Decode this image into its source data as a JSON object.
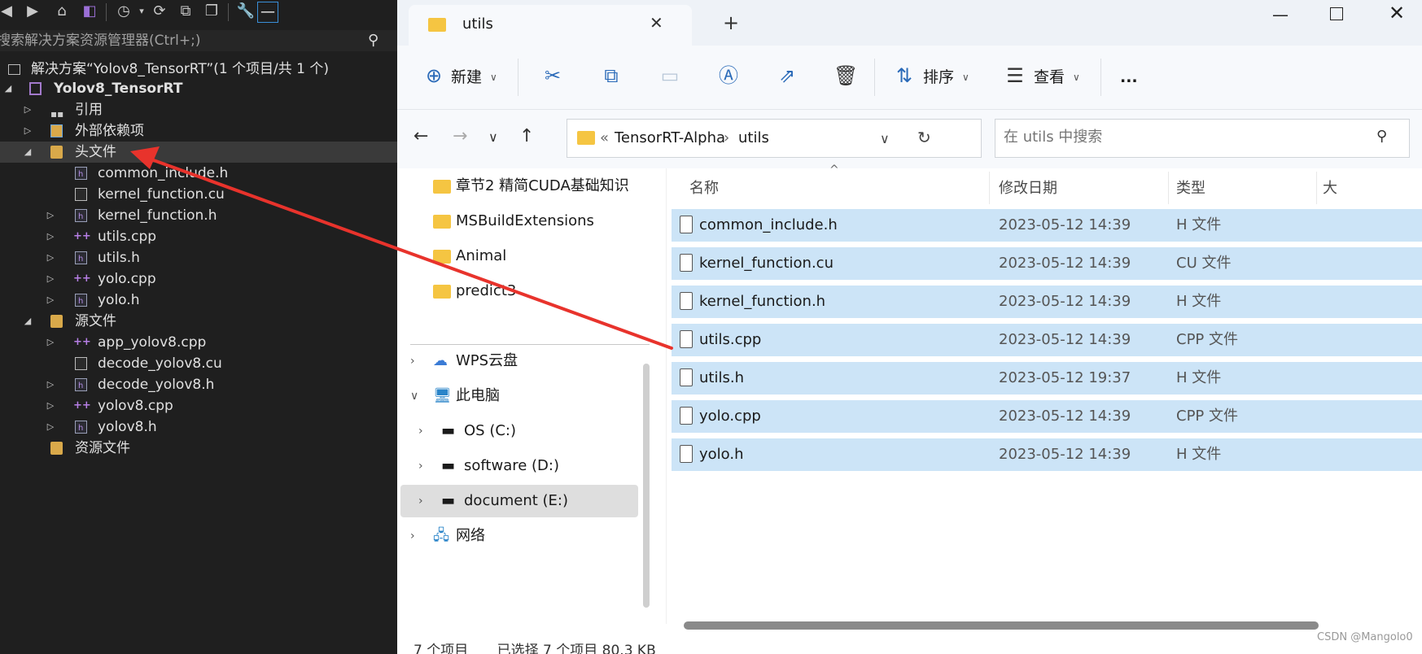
{
  "solution_explorer": {
    "search_placeholder": "搜索解决方案资源管理器(Ctrl+;)",
    "solution_label": "解决方案“Yolov8_TensorRT”(1 个项目/共 1 个)",
    "project_label": "Yolov8_TensorRT",
    "nodes": {
      "references": "引用",
      "external_deps": "外部依赖项",
      "header_files": "头文件",
      "h1": "common_include.h",
      "h2": "kernel_function.cu",
      "h3": "kernel_function.h",
      "h4": "utils.cpp",
      "h5": "utils.h",
      "h6": "yolo.cpp",
      "h7": "yolo.h",
      "source_files": "源文件",
      "s1": "app_yolov8.cpp",
      "s2": "decode_yolov8.cu",
      "s3": "decode_yolov8.h",
      "s4": "yolov8.cpp",
      "s5": "yolov8.h",
      "resource_files": "资源文件"
    }
  },
  "explorer": {
    "tab_title": "utils",
    "commands": {
      "new": "新建",
      "sort": "排序",
      "view": "查看",
      "more": "..."
    },
    "breadcrumb": {
      "prefix": "«",
      "parent": "TensorRT-Alpha",
      "current": "utils"
    },
    "search_placeholder": "在 utils 中搜索",
    "nav_items": {
      "n1": "章节2 精简CUDA基础知识",
      "n2": "MSBuildExtensions",
      "n3": "Animal",
      "n4": "predict3",
      "n5": "WPS云盘",
      "n6": "此电脑",
      "n7": "OS (C:)",
      "n8": "software (D:)",
      "n9": "document (E:)",
      "n10": "网络"
    },
    "columns": {
      "name": "名称",
      "date": "修改日期",
      "type": "类型",
      "size": "大"
    },
    "files": [
      {
        "name": "common_include.h",
        "date": "2023-05-12 14:39",
        "type": "H 文件"
      },
      {
        "name": "kernel_function.cu",
        "date": "2023-05-12 14:39",
        "type": "CU 文件"
      },
      {
        "name": "kernel_function.h",
        "date": "2023-05-12 14:39",
        "type": "H 文件"
      },
      {
        "name": "utils.cpp",
        "date": "2023-05-12 14:39",
        "type": "CPP 文件"
      },
      {
        "name": "utils.h",
        "date": "2023-05-12 19:37",
        "type": "H 文件"
      },
      {
        "name": "yolo.cpp",
        "date": "2023-05-12 14:39",
        "type": "CPP 文件"
      },
      {
        "name": "yolo.h",
        "date": "2023-05-12 14:39",
        "type": "H 文件"
      }
    ],
    "status": {
      "count": "7 个项目",
      "selected": "已选择 7 个项目 80.3 KB"
    },
    "watermark": "CSDN @Mangolo0"
  },
  "colors": {
    "selection": "#cce4f7",
    "vs_bg": "#1f1f1f",
    "arrow": "#e8332c",
    "folder": "#f5c542"
  }
}
